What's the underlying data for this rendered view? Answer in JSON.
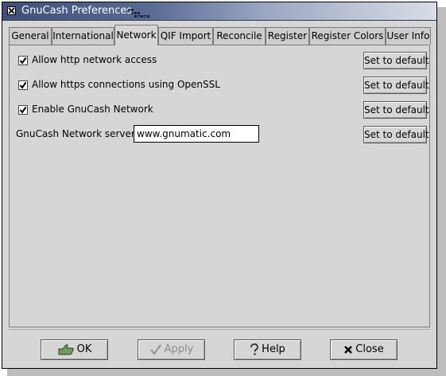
{
  "window": {
    "title": "GnuCash Preferences"
  },
  "tabs": [
    {
      "label": "General"
    },
    {
      "label": "International"
    },
    {
      "label": "Network",
      "active": true
    },
    {
      "label": "QIF Import"
    },
    {
      "label": "Reconcile"
    },
    {
      "label": "Register"
    },
    {
      "label": "Register Colors"
    },
    {
      "label": "User Info"
    }
  ],
  "network": {
    "http_access": {
      "label": "Allow http network access",
      "checked": true
    },
    "https_access": {
      "label": "Allow https connections using OpenSSL",
      "checked": true
    },
    "enable_network": {
      "label": "Enable GnuCash Network",
      "checked": true
    },
    "server": {
      "label": "GnuCash Network server:",
      "value": "www.gnumatic.com"
    },
    "default_label": "Set to default"
  },
  "actions": {
    "ok": "OK",
    "apply": "Apply",
    "help": "Help",
    "close": "Close"
  },
  "icons": {
    "ok": "ok-hand-icon",
    "apply": "checkmark-icon",
    "help": "question-icon",
    "close": "x-close-icon"
  }
}
